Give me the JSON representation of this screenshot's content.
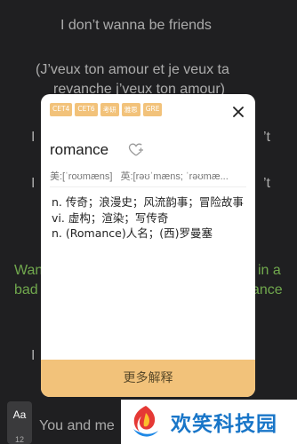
{
  "lyrics": {
    "line1": "I don’t wanna be friends",
    "line2": "(J’veux ton amour et je veux ta",
    "line3": "revanche j’veux ton amour)",
    "frag_left1": "I",
    "frag_right1": "’t",
    "frag_left2": "I",
    "frag_right2": "’t",
    "hl_left1": "Wan",
    "hl_left2": "bad",
    "hl_right1": "in a",
    "hl_right2": "ance",
    "frag_left3": "I",
    "bottom_line": "You and me"
  },
  "popup": {
    "tags": [
      "CET4",
      "CET6",
      "考研",
      "雅思",
      "GRE"
    ],
    "word": "romance",
    "phonetic_us": "美:[ˈroʊmæns]",
    "phonetic_uk": "英:[rəʊˈmæns; ˈrəʊmæ...",
    "definitions": [
      "n. 传奇；浪漫史；风流韵事；冒险故事",
      "vi. 虚构；渲染；写传奇",
      "n. (Romance)人名；(西)罗曼塞"
    ],
    "more_button": "更多解释"
  },
  "font_control": {
    "label": "Aa",
    "size": "12"
  },
  "watermark": {
    "text": "欢笑科技园"
  },
  "colors": {
    "highlight": "#9be86b",
    "accent": "#f2c27a",
    "brand": "#1976c8"
  }
}
